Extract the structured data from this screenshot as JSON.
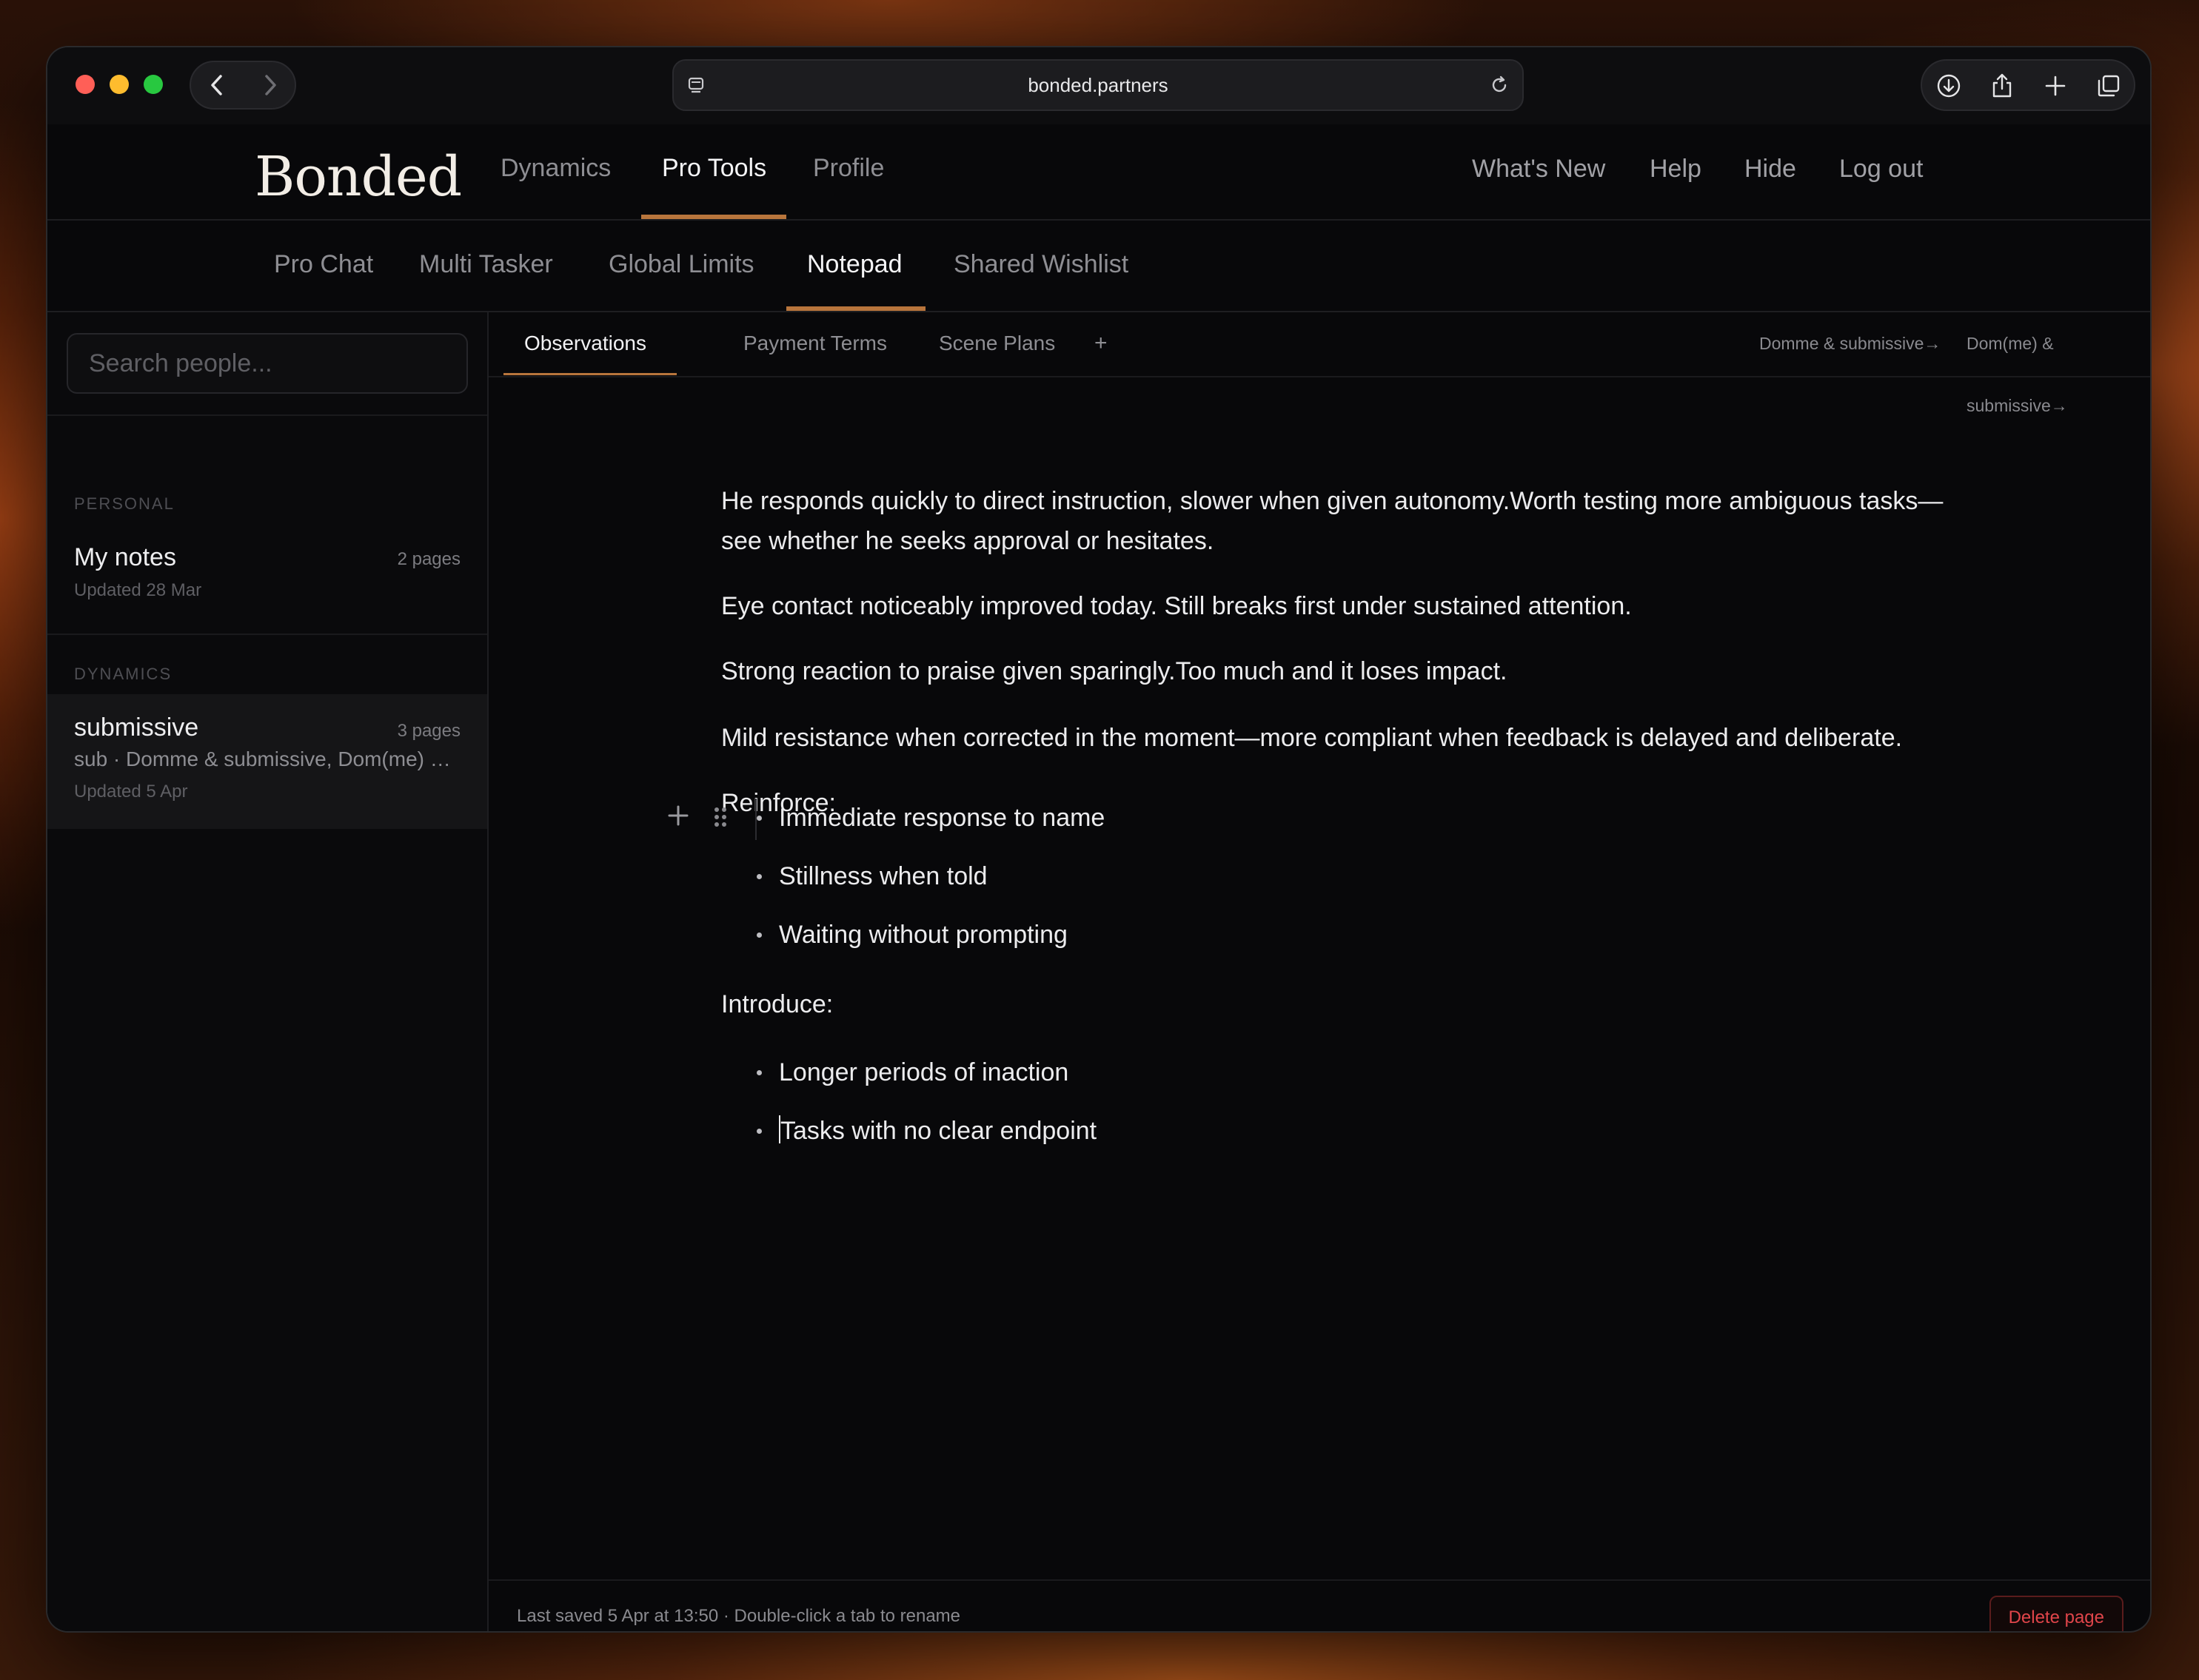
{
  "browser": {
    "url": "bonded.partners"
  },
  "app": {
    "logo": "Bonded",
    "nav": [
      {
        "label": "Dynamics",
        "active": false
      },
      {
        "label": "Pro Tools",
        "active": true
      },
      {
        "label": "Profile",
        "active": false
      }
    ],
    "nav_right": [
      "What's New",
      "Help",
      "Hide",
      "Log out"
    ],
    "subnav": [
      {
        "label": "Pro Chat",
        "active": false
      },
      {
        "label": "Multi Tasker",
        "active": false
      },
      {
        "label": "Global Limits",
        "active": false
      },
      {
        "label": "Notepad",
        "active": true
      },
      {
        "label": "Shared Wishlist",
        "active": false
      }
    ],
    "accent_color": "#b8753c"
  },
  "sidebar": {
    "search_placeholder": "Search people...",
    "sections": [
      {
        "title": "PERSONAL",
        "items": [
          {
            "title": "My notes",
            "count": "2 pages",
            "sub": "",
            "updated": "Updated 28 Mar",
            "selected": false
          }
        ]
      },
      {
        "title": "DYNAMICS",
        "items": [
          {
            "title": "submissive",
            "count": "3 pages",
            "sub": "sub · Domme & submissive, Dom(me) & submissive",
            "updated": "Updated 5 Apr",
            "selected": true
          }
        ]
      }
    ]
  },
  "main": {
    "tabs": [
      {
        "label": "Observations",
        "active": true
      },
      {
        "label": "Payment Terms",
        "active": false
      },
      {
        "label": "Scene Plans",
        "active": false
      }
    ],
    "add_tab": "+",
    "dynamic_links": [
      "Domme & submissive→",
      "Dom(me) & submissive→"
    ],
    "paragraphs": [
      "He responds quickly to direct instruction, slower when given autonomy.Worth testing more ambiguous tasks—see whether he seeks approval or hesitates.",
      "Eye contact noticeably improved today. Still breaks first under sustained attention.",
      "Strong reaction to praise given sparingly.Too much and it loses impact.",
      "Mild resistance when corrected in the moment—more compliant when feedback is delayed and deliberate.",
      "Reinforce:"
    ],
    "reinforce_list": [
      "Immediate response to name",
      "Stillness when told",
      "Waiting without prompting"
    ],
    "introduce_label": "Introduce:",
    "introduce_list": [
      "Longer periods of inaction",
      "Tasks with no clear endpoint"
    ],
    "footer_text": "Last saved 5 Apr at 13:50 · Double-click a tab to rename",
    "delete_label": "Delete page"
  }
}
